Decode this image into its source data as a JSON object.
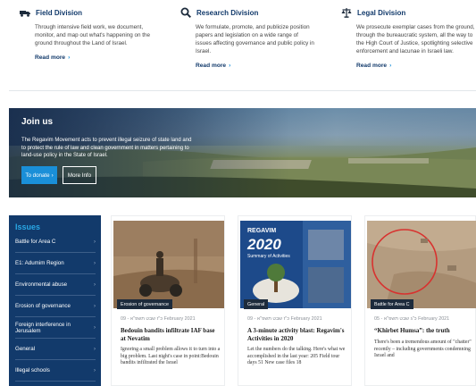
{
  "divisions": [
    {
      "icon": "truck-icon",
      "title": "Field Division",
      "desc": "Through intensive field work, we document, monitor, and map out what's happening on the ground throughout the Land of Israel.",
      "more": "Read more"
    },
    {
      "icon": "magnifier-icon",
      "title": "Research Division",
      "desc": "We formulate, promote, and publicize position papers and legislation on a wide range of issues affecting governance and public policy in Israel.",
      "more": "Read more"
    },
    {
      "icon": "scales-icon",
      "title": "Legal Division",
      "desc": "We prosecute exemplar cases from the ground, through the bureaucratic system, all the way to the High Court of Justice, spotlighting selective enforcement and lacunae in Israeli law.",
      "more": "Read more"
    }
  ],
  "hero": {
    "title": "Join us",
    "text": "The Regavim Movement acts to prevent illegal seizure of state land and to protect the rule of law and clean government in matters pertaining to land-use policy in the State of Israel.",
    "donate": "To donate",
    "more": "More Info"
  },
  "sidebar": {
    "title": "Issues",
    "items": [
      "Battle for Area C",
      "E1: Adumim Region",
      "Environmental abuse",
      "Erosion of governance",
      "Foreign interference in Jerusalem",
      "General",
      "Illegal schools"
    ]
  },
  "cards": [
    {
      "badge": "Erosion of governance",
      "meta": "כ\"ז שבט תשפ\"א - 09 February 2021",
      "title": "Bedouin bandits infiltrate IAF base at Nevatim",
      "excerpt": "Ignoring a small problem allows it to turn into a big problem. Last night's case in point:Bedouin bandits infiltrated the Israel"
    },
    {
      "badge": "General",
      "meta": "כ\"ז שבט תשפ\"א - 09 February 2021",
      "title": "A 3-minute activity blast: Regavim's Activities in 2020",
      "excerpt": "Let the numbers do the talking. Here's what we accomplished in the last year: 205 Field tour days 51 New case files 18",
      "image_text": {
        "brand": "REGAVIM",
        "year": "2020",
        "sub": "Summary of Activities"
      }
    },
    {
      "badge": "Battle for Area C",
      "meta": "כ\"ג שבט תשפ\"א - 05 February 2021",
      "title": "“Khirbet Humsa”: the truth",
      "excerpt": "There's been a tremendous amount of \"chatter\" recently – including governments condemning Israel and"
    }
  ],
  "colors": {
    "navy": "#123a6b",
    "accent": "#1a8fd8",
    "issues_title": "#29a8e6"
  }
}
